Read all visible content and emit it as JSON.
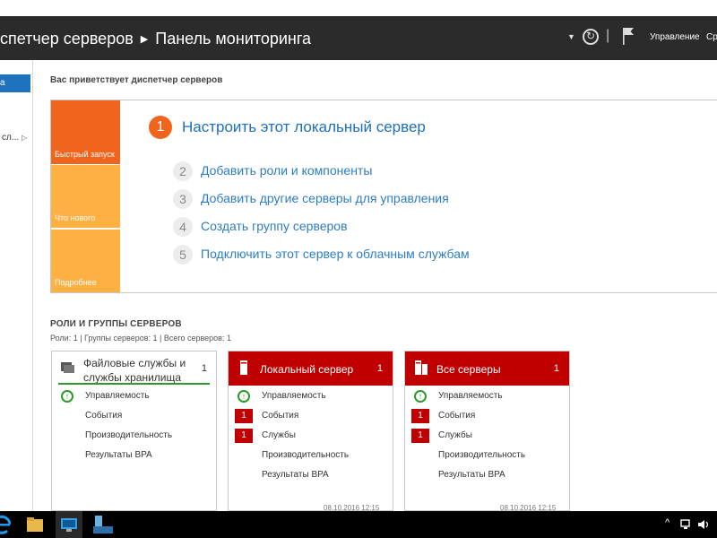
{
  "titlebar": {
    "breadcrumb_app": "спетчер серверов",
    "breadcrumb_page": "Панель мониторинга",
    "menu_manage": "Управление",
    "menu_cut": "Ср"
  },
  "nav": {
    "selected_label": "а",
    "item_label": "сл..."
  },
  "welcome_title": "Вас приветствует диспетчер серверов",
  "quickstart": {
    "tiles": [
      "Быстрый запуск",
      "Что нового",
      "Подробнее"
    ],
    "step1_num": "1",
    "step1_text": "Настроить этот локальный сервер",
    "steps": [
      {
        "num": "2",
        "text": "Добавить роли и компоненты"
      },
      {
        "num": "3",
        "text": "Добавить другие серверы для управления"
      },
      {
        "num": "4",
        "text": "Создать группу серверов"
      },
      {
        "num": "5",
        "text": "Подключить этот сервер к облачным службам"
      }
    ]
  },
  "roles_section": {
    "title": "РОЛИ И ГРУППЫ СЕРВЕРОВ",
    "subtitle": "Роли: 1 | Группы серверов: 1 | Всего серверов: 1"
  },
  "cards": [
    {
      "title_line1": "Файловые службы и",
      "title_line2": "службы хранилища",
      "count": "1",
      "rows": [
        "Управляемость",
        "События",
        "Производительность",
        "Результаты BPA"
      ]
    },
    {
      "title": "Локальный сервер",
      "count": "1",
      "rows": [
        "Управляемость",
        "События",
        "Службы",
        "Производительность",
        "Результаты BPA"
      ],
      "badges": [
        "1",
        "1"
      ],
      "date": "08.10.2016 12:15"
    },
    {
      "title": "Все серверы",
      "count": "1",
      "rows": [
        "Управляемость",
        "События",
        "Службы",
        "Производительность",
        "Результаты BPA"
      ],
      "badges": [
        "1",
        "1"
      ],
      "date": "08.10.2016 12:15"
    }
  ],
  "colors": {
    "accent_blue": "#1e73be",
    "orange": "#f0641e",
    "amber": "#ffb043",
    "card_red": "#c00000",
    "ok_green": "#2e9a2e"
  }
}
